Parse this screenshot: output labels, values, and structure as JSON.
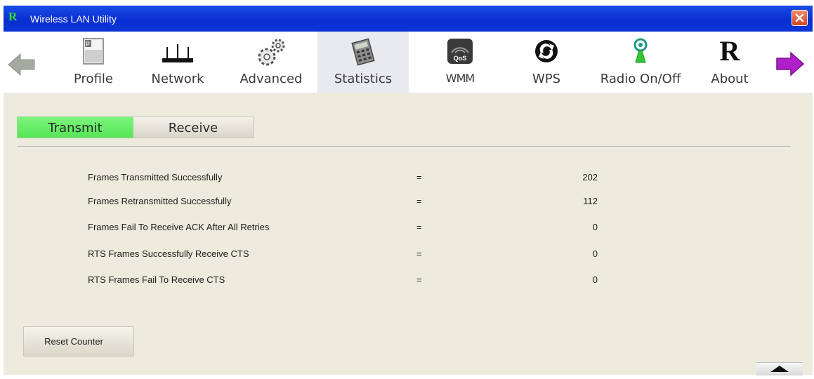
{
  "window": {
    "title": "Wireless LAN Utility",
    "app_icon_letter": "R"
  },
  "toolbar": {
    "items": [
      {
        "label": "Profile",
        "icon": "profile-icon"
      },
      {
        "label": "Network",
        "icon": "network-icon"
      },
      {
        "label": "Advanced",
        "icon": "gears-icon"
      },
      {
        "label": "Statistics",
        "icon": "statistics-icon",
        "active": true
      },
      {
        "label": "WMM",
        "icon": "qos-icon",
        "badge": "QoS"
      },
      {
        "label": "WPS",
        "icon": "wps-icon"
      },
      {
        "label": "Radio On/Off",
        "icon": "radio-antenna-icon"
      },
      {
        "label": "About",
        "icon": "about-icon",
        "glyph": "R"
      }
    ]
  },
  "tabs": [
    {
      "label": "Transmit",
      "active": true
    },
    {
      "label": "Receive",
      "active": false
    }
  ],
  "stats": [
    {
      "label": "Frames Transmitted Successfully",
      "eq": "=",
      "value": "202"
    },
    {
      "label": "Frames Retransmitted Successfully",
      "eq": "=",
      "value": "112"
    },
    {
      "label": "Frames Fail To Receive ACK After All Retries",
      "eq": "=",
      "value": "0"
    },
    {
      "label": "RTS Frames Successfully Receive CTS",
      "eq": "=",
      "value": "0"
    },
    {
      "label": "RTS Frames Fail To Receive CTS",
      "eq": "=",
      "value": "0"
    }
  ],
  "buttons": {
    "reset": "Reset Counter"
  },
  "colors": {
    "titlebar": "#0a2fd0",
    "active_tab": "#55e455",
    "panel": "#ecebdd",
    "forward_arrow": "#b020c8"
  }
}
